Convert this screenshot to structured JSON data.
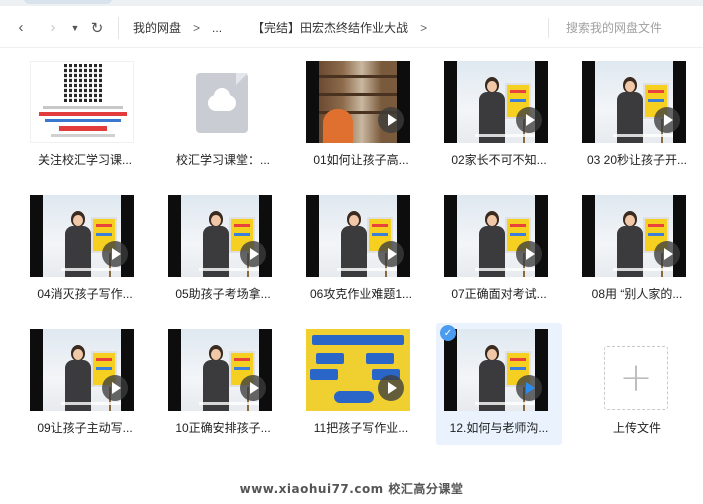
{
  "navbar": {
    "back_icon": "chevron-left-icon",
    "forward_icon": "chevron-right-icon",
    "history_icon": "caret-down-icon",
    "refresh_icon": "refresh-icon",
    "breadcrumb": [
      "我的网盘",
      "...",
      "【完结】田宏杰终结作业大战"
    ],
    "separator": ">",
    "search_placeholder": "搜索我的网盘文件"
  },
  "files": [
    {
      "name": "关注校汇学习课...",
      "kind": "poster"
    },
    {
      "name": "校汇学习课堂：...",
      "kind": "doc"
    },
    {
      "name": "01如何让孩子高...",
      "kind": "video",
      "scene": "library"
    },
    {
      "name": "02家长不可不知...",
      "kind": "video"
    },
    {
      "name": "03 20秒让孩子开...",
      "kind": "video"
    },
    {
      "name": "04消灭孩子写作...",
      "kind": "video"
    },
    {
      "name": "05助孩子考场拿...",
      "kind": "video"
    },
    {
      "name": "06攻克作业难题1...",
      "kind": "video"
    },
    {
      "name": "07正确面对考试...",
      "kind": "video"
    },
    {
      "name": "08用 “别人家的...",
      "kind": "video"
    },
    {
      "name": "09让孩子主动写...",
      "kind": "video"
    },
    {
      "name": "10正确安排孩子...",
      "kind": "video"
    },
    {
      "name": "11把孩子写作业...",
      "kind": "video",
      "scene": "slide"
    },
    {
      "name": "12.如何与老师沟...",
      "kind": "video",
      "selected": true
    }
  ],
  "upload": {
    "label": "上传文件",
    "icon": "plus-icon"
  },
  "watermark": "www.xiaohui77.com 校汇高分课堂",
  "colors": {
    "accent": "#2b8cf0",
    "selected_bg": "#eaf3fd",
    "board_yellow": "#f5d020"
  }
}
